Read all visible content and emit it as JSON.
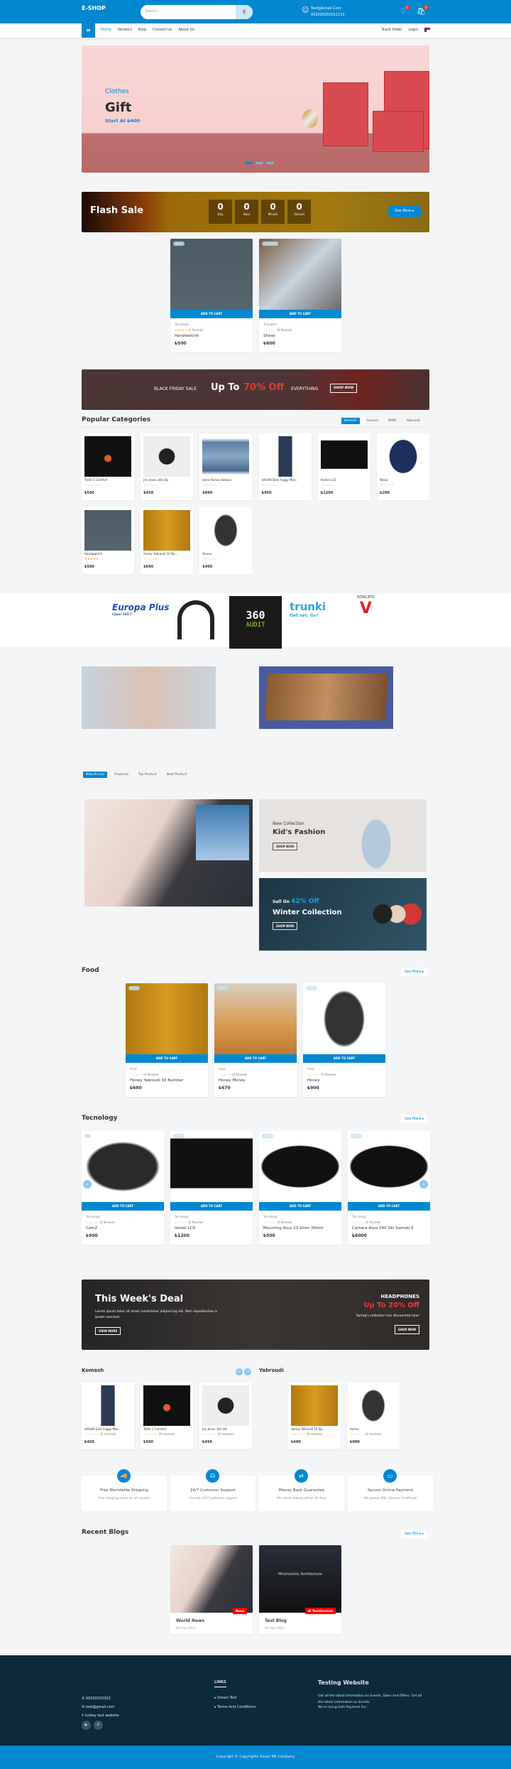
{
  "header": {
    "logo": "E-SHOP",
    "search_placeholder": "Search...",
    "email": "Test@Gmail.Com",
    "phone": "002020202011111",
    "wishlist_count": "0",
    "cart_count": "0"
  },
  "nav": {
    "links": [
      "Home",
      "Vendors",
      "Blog",
      "Contact Us",
      "About Us"
    ],
    "track_order": "Track Order",
    "login": "Login"
  },
  "hero": {
    "category": "Clothes",
    "title": "Gift",
    "subtitle": "Start At ₺400",
    "slides": 3,
    "active_slide": 1
  },
  "flash_sale": {
    "title": "Flash Sale",
    "countdown": [
      {
        "value": "0",
        "label": "Day"
      },
      {
        "value": "0",
        "label": "Hour"
      },
      {
        "value": "0",
        "label": "Minute"
      },
      {
        "value": "0",
        "label": "Second"
      }
    ],
    "see_more": "See More ▸"
  },
  "flash_products": [
    {
      "tag": "New",
      "category": "Tecnology",
      "rating": 5,
      "reviews": "(1 Review)",
      "name": "Handwatchh",
      "price": "₺500",
      "img": "watch"
    },
    {
      "tag": "Featured",
      "category": "Transport",
      "rating": 0,
      "reviews": "(0 Review)",
      "name": "Shose",
      "price": "₺600",
      "img": "shoe"
    }
  ],
  "add_to_cart": "ADD TO CART",
  "black_friday": {
    "label": "BLACK FRIDAY SALE",
    "headline": "Up To",
    "highlight": "70% Off",
    "suffix": "EVERYTHING",
    "button": "SHOP NOW"
  },
  "popular": {
    "title": "Popular Categories",
    "tabs": [
      "Komash",
      "Lenovo",
      "BMW",
      "Yabroudi"
    ],
    "active_tab": "Komash",
    "items": [
      {
        "name": "Tshitr 1 Comfort",
        "price": "₺560",
        "rating": 0,
        "img": "tshirt"
      },
      {
        "name": "Jrei Jeans 344 Oki",
        "price": "₺458",
        "rating": 0,
        "img": "swatch"
      },
      {
        "name": "Jeans Komas Kotano",
        "price": "₺890",
        "rating": 0,
        "img": "jeans"
      },
      {
        "name": "HASAN Dark Foggy Mav...",
        "price": "₺450",
        "rating": 0,
        "img": "pants"
      },
      {
        "name": "Vestel LCD",
        "price": "₺1200",
        "rating": 0,
        "img": "tv"
      },
      {
        "name": "Nokia",
        "price": "₺200",
        "rating": 0,
        "img": "bag"
      },
      {
        "name": "Handwatchh",
        "price": "₺500",
        "rating": 5,
        "img": "watch"
      },
      {
        "name": "Honey Yabroudi 10 Nu...",
        "price": "₺680",
        "rating": 0,
        "img": "honey"
      },
      {
        "name": "Honey",
        "price": "₺900",
        "rating": 0,
        "img": "chair"
      }
    ]
  },
  "brands": [
    {
      "name": "Europa Plus",
      "sub": "Сарос 102.7"
    },
    {
      "name": "headphones"
    },
    {
      "name": "360",
      "sub": "AUDIT"
    },
    {
      "name": "trunki",
      "sub": "Get set. Go!"
    },
    {
      "name": "RONCATO"
    }
  ],
  "product_tabs": [
    "New Arrival",
    "Featured",
    "Top Product",
    "Best Product"
  ],
  "kids_banner": {
    "pre": "New Collection",
    "title": "Kid's Fashion",
    "button": "SHOP NOW"
  },
  "winter_banner": {
    "pre": "Sell On",
    "highlight": "42% Off",
    "title": "Winter Collection",
    "button": "SHOP NOW"
  },
  "food": {
    "title": "Food",
    "see_more": "See More ▸",
    "items": [
      {
        "tag": "Sale",
        "category": "Food",
        "rating": 0,
        "reviews": "(0 Review)",
        "name": "Honey Yabroudi 10 Number",
        "price": "₺680",
        "img": "honey"
      },
      {
        "tag": "New",
        "category": "Food",
        "rating": 0,
        "reviews": "(0 Review)",
        "name": "Honey Money",
        "price": "₺670",
        "img": "comb"
      },
      {
        "tag": "New",
        "category": "Food",
        "rating": 0,
        "reviews": "(0 Review)",
        "name": "Honey",
        "price": "₺900",
        "img": "chair"
      }
    ]
  },
  "tech": {
    "title": "Tecnology",
    "see_more": "See More ▸",
    "items": [
      {
        "tag": "",
        "category": "Tecnology",
        "rating": 0,
        "reviews": "(0 Review)",
        "name": "Cam2",
        "price": "₺900",
        "img": "cam"
      },
      {
        "tag": "New",
        "category": "Tecnology",
        "rating": 0,
        "reviews": "(0 Review)",
        "name": "Vestel LCD",
        "price": "₺1200",
        "img": "tv"
      },
      {
        "tag": "New",
        "category": "Tecnology",
        "rating": 0,
        "reviews": "(0 Review)",
        "name": "Mounting Asus 23.2mm 30mm",
        "price": "₺500",
        "img": "lens"
      },
      {
        "tag": "New",
        "category": "Tecnology",
        "rating": 0,
        "reviews": "(0 Review)",
        "name": "Camera Asus 340 Oki Samoki S",
        "price": "₺6000",
        "img": "lens"
      }
    ]
  },
  "week_deal": {
    "title": "This Week's Deal",
    "text": "Lorem ipsum dolor sit amet consectetur adipisicing elit. Rem repudiandae in ipsam nesciunt.",
    "button": "VIEW MORE",
    "right_title": "HEADPHONES",
    "right_highlight": "Up To 20% Off",
    "right_text": "Spring's collection has discounted now!",
    "right_button": "SHOP NOW"
  },
  "komash": {
    "title": "Komash",
    "items": [
      {
        "name": "HASAN Dark Foggy Mav...",
        "price": "₺450",
        "reviews": "(0 review)",
        "img": "pants"
      },
      {
        "name": "Tshitr 1 Comfort",
        "price": "₺560",
        "reviews": "(0 review)",
        "img": "tshirt"
      },
      {
        "name": "Jrei Jeans 344 Oki",
        "price": "₺458",
        "reviews": "(0 review)",
        "img": "swatch"
      }
    ]
  },
  "yabroudi": {
    "title": "Yabroudi",
    "items": [
      {
        "name": "Honey Yabroudi 10 Nu...",
        "price": "₺680",
        "reviews": "(0 review)",
        "img": "honey"
      },
      {
        "name": "Honey",
        "price": "₺900",
        "reviews": "(0 review)",
        "img": "chair"
      }
    ]
  },
  "features": [
    {
      "icon": "truck-icon",
      "glyph": "🚚",
      "title": "Free Worldwide Shipping",
      "desc": "Free shipping coast for all country"
    },
    {
      "icon": "headset-icon",
      "glyph": "☊",
      "title": "24/7 Customer Support",
      "desc": "Friendly 24/7 customer support"
    },
    {
      "icon": "exchange-icon",
      "glyph": "⇄",
      "title": "Money Back Guarantee",
      "desc": "We return money within 30 days"
    },
    {
      "icon": "credit-card-icon",
      "glyph": "▭",
      "title": "Secure Online Payment",
      "desc": "We posess SSL / Secure Certificate"
    }
  ],
  "blogs": {
    "title": "Recent Blogs",
    "see_more": "See More ▸",
    "items": [
      {
        "badge": "News",
        "title": "World News",
        "date": "Oct Sun 2023",
        "img": "laptop"
      },
      {
        "badge": "AI TechServices",
        "title": "Test Blog",
        "date": "Oct Sun 2023",
        "img": "arch",
        "overlay": "Minimalistic Architecture"
      }
    ]
  },
  "footer": {
    "logo": "logo",
    "phone": "00202020202",
    "email": "test@gmail.com",
    "address": "turkey test website",
    "links_title": "LINKS",
    "links": [
      "Dosan Test",
      "Terms And Conditions"
    ],
    "site_title": "Testing Website",
    "about": "Get all the latest information on Events, Sales and Offers. Get all the latest information on Events.",
    "payment": "We're Using Safe Payment For :",
    "copyright": "Copyright © Copyrights Smart Mk Company"
  },
  "colors": {
    "primary": "#0288d1",
    "footer": "#0b2a3b",
    "sale_red": "#e53935",
    "star": "#f4a524"
  }
}
